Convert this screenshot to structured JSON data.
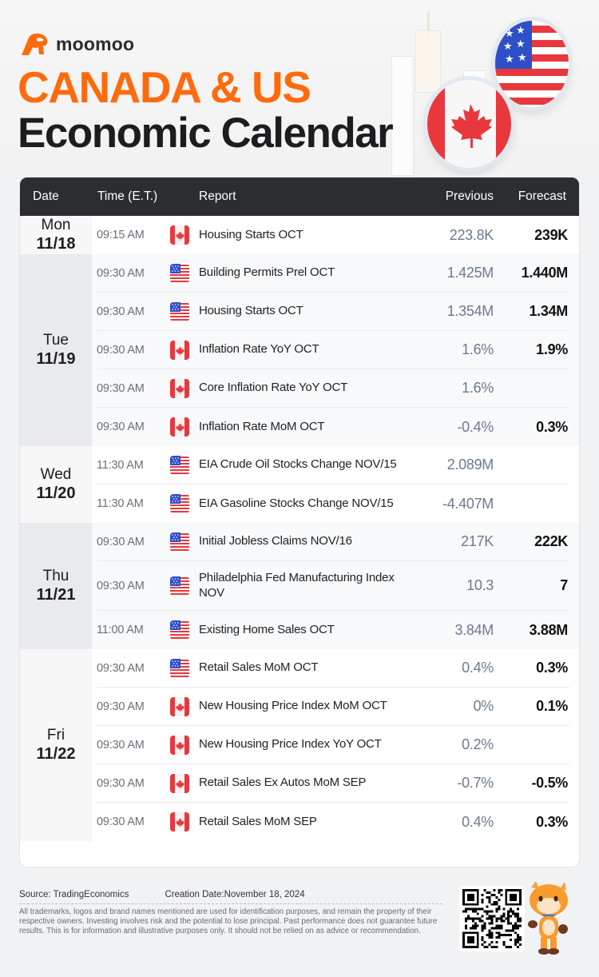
{
  "header": {
    "brand": "moomoo",
    "title_line1": "CANADA & US",
    "title_line2": "Economic Calendar",
    "brand_color": "#ff6a0c"
  },
  "table": {
    "columns": {
      "date": "Date",
      "time": "Time (E.T.)",
      "report": "Report",
      "previous": "Previous",
      "forecast": "Forecast"
    },
    "groups": [
      {
        "day": "Mon",
        "date": "11/18",
        "rows": [
          {
            "time": "09:15 AM",
            "country": "canada-flag",
            "report": "Housing Starts OCT",
            "previous": "223.8K",
            "forecast": "239K"
          }
        ]
      },
      {
        "day": "Tue",
        "date": "11/19",
        "rows": [
          {
            "time": "09:30 AM",
            "country": "us-flag",
            "report": "Building Permits Prel OCT",
            "previous": "1.425M",
            "forecast": "1.440M"
          },
          {
            "time": "09:30 AM",
            "country": "us-flag",
            "report": "Housing Starts OCT",
            "previous": "1.354M",
            "forecast": "1.34M"
          },
          {
            "time": "09:30 AM",
            "country": "canada-flag",
            "report": "Inflation Rate YoY OCT",
            "previous": "1.6%",
            "forecast": "1.9%"
          },
          {
            "time": "09:30 AM",
            "country": "canada-flag",
            "report": "Core Inflation Rate YoY OCT",
            "previous": "1.6%",
            "forecast": ""
          },
          {
            "time": "09:30 AM",
            "country": "canada-flag",
            "report": "Inflation Rate MoM OCT",
            "previous": "-0.4%",
            "forecast": "0.3%"
          }
        ]
      },
      {
        "day": "Wed",
        "date": "11/20",
        "rows": [
          {
            "time": "11:30 AM",
            "country": "us-flag",
            "report": "EIA Crude Oil Stocks Change NOV/15",
            "previous": "2.089M",
            "forecast": ""
          },
          {
            "time": "11:30 AM",
            "country": "us-flag",
            "report": "EIA Gasoline Stocks Change NOV/15",
            "previous": "-4.407M",
            "forecast": ""
          }
        ]
      },
      {
        "day": "Thu",
        "date": "11/21",
        "rows": [
          {
            "time": "09:30 AM",
            "country": "us-flag",
            "report": "Initial Jobless Claims NOV/16",
            "previous": "217K",
            "forecast": "222K"
          },
          {
            "time": "09:30 AM",
            "country": "us-flag",
            "report": "Philadelphia Fed Manufacturing Index NOV",
            "previous": "10.3",
            "forecast": "7"
          },
          {
            "time": "11:00 AM",
            "country": "us-flag",
            "report": "Existing Home Sales OCT",
            "previous": "3.84M",
            "forecast": "3.88M"
          }
        ]
      },
      {
        "day": "Fri",
        "date": "11/22",
        "rows": [
          {
            "time": "09:30 AM",
            "country": "us-flag",
            "report": "Retail Sales MoM OCT",
            "previous": "0.4%",
            "forecast": "0.3%"
          },
          {
            "time": "09:30 AM",
            "country": "canada-flag",
            "report": "New Housing Price Index MoM OCT",
            "previous": "0%",
            "forecast": "0.1%"
          },
          {
            "time": "09:30 AM",
            "country": "canada-flag",
            "report": "New Housing Price Index YoY OCT",
            "previous": "0.2%",
            "forecast": ""
          },
          {
            "time": "09:30 AM",
            "country": "canada-flag",
            "report": "Retail Sales Ex Autos MoM SEP",
            "previous": "-0.7%",
            "forecast": "-0.5%"
          },
          {
            "time": "09:30 AM",
            "country": "canada-flag",
            "report": "Retail Sales MoM SEP",
            "previous": "0.4%",
            "forecast": "0.3%"
          }
        ]
      }
    ]
  },
  "footer": {
    "source": "Source: TradingEconomics",
    "creation_date": "Creation Date:November 18, 2024",
    "disclaimer": "All trademarks, logos and brand names mentioned are used for identification purposes, and remain the property of their respective owners. Investing involves risk and the potential to lose principal. Past performance does not guarantee future results. This is for information and illustrative purposes only. It should not be relied on as advice or recommendation."
  }
}
